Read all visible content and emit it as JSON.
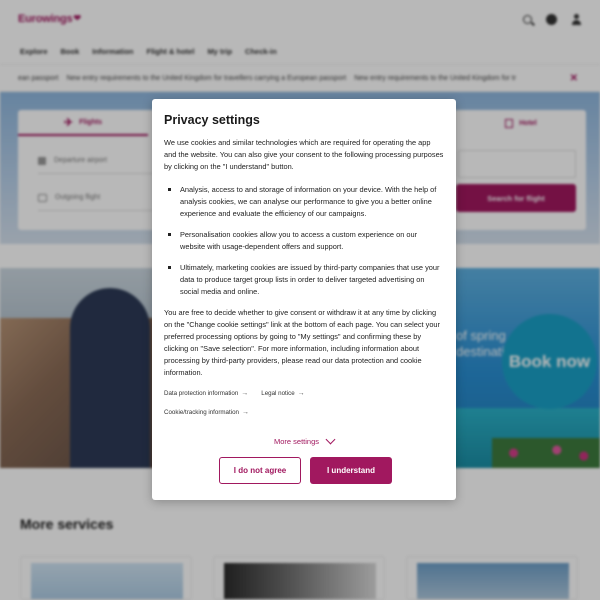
{
  "header": {
    "logo": "Eurowings",
    "icons": [
      "search-icon",
      "globe-icon",
      "user-icon"
    ]
  },
  "nav": [
    "Explore",
    "Book",
    "Information",
    "Flight & hotel",
    "My trip",
    "Check-in"
  ],
  "ticker": {
    "items": [
      "ean passport",
      "New entry requirements to the United Kingdom for travellers carrying a European passport",
      "New entry requirements to the United Kingdom for tr"
    ]
  },
  "booking": {
    "tab_flights": "Flights",
    "tab_hotel": "Hotel",
    "departure_placeholder": "Departure airport",
    "outgoing_placeholder": "Outgoing flight",
    "search_button": "Search for flight"
  },
  "promo": {
    "text": "of spring\ndestinations",
    "book_now": "Book now"
  },
  "more_services": {
    "title": "More services"
  },
  "modal": {
    "title": "Privacy settings",
    "intro": "We use cookies and similar technologies which are required for operating the app and the website. You can also give your consent to the following processing purposes by clicking on the \"I understand\" button.",
    "bullets": [
      "Analysis, access to and storage of information on your device. With the help of analysis cookies, we can analyse our performance to give you a better online experience and evaluate the efficiency of our campaigns.",
      "Personalisation cookies allow you to access a custom experience on our website with usage-dependent offers and support.",
      "Ultimately, marketing cookies are issued by third-party companies that use your data to produce target group lists in order to deliver targeted advertising on social media and online."
    ],
    "outro": "You are free to decide whether to give consent or withdraw it at any time by clicking on the \"Change cookie settings\" link at the bottom of each page. You can select your preferred processing options by going to \"My settings\" and confirming these by clicking on \"Save selection\". For more information, including information about processing by third-party providers, please read our data protection and cookie information.",
    "links": {
      "data_protection": "Data protection information",
      "legal_notice": "Legal notice",
      "cookie_info": "Cookie/tracking information"
    },
    "more_settings": "More settings",
    "btn_disagree": "I do not agree",
    "btn_agree": "I understand"
  },
  "colors": {
    "brand": "#a1185f",
    "overlay": "rgba(0,0,0,0.28)"
  }
}
